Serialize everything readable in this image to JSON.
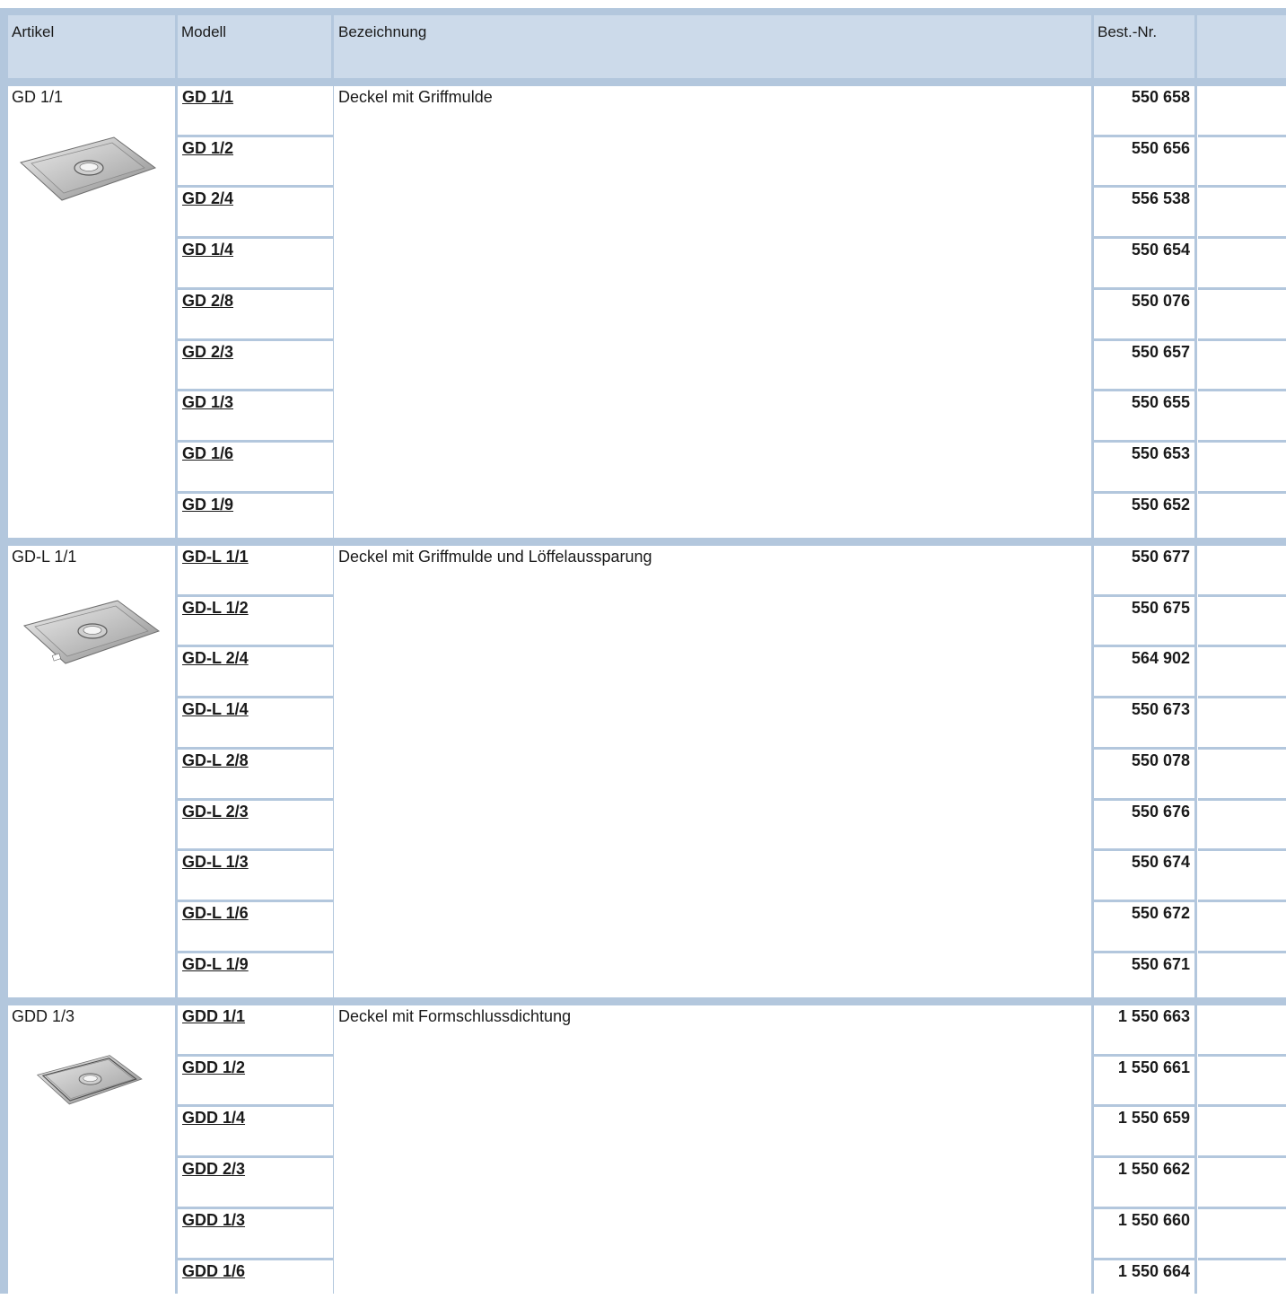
{
  "header": {
    "artikel": "Artikel",
    "modell": "Modell",
    "bezeichnung": "Bezeichnung",
    "best_nr": "Best.-Nr."
  },
  "groups": [
    {
      "artikel": "GD 1/1",
      "image": "gastronorm-lid-with-handle-recess",
      "bezeichnung": "Deckel mit Griffmulde",
      "rows": [
        {
          "modell": "GD 1/1",
          "best_nr": "550 658"
        },
        {
          "modell": "GD 1/2",
          "best_nr": "550 656"
        },
        {
          "modell": "GD 2/4",
          "best_nr": "556 538"
        },
        {
          "modell": "GD 1/4",
          "best_nr": "550 654"
        },
        {
          "modell": "GD 2/8",
          "best_nr": "550 076"
        },
        {
          "modell": "GD 2/3",
          "best_nr": "550 657"
        },
        {
          "modell": "GD 1/3",
          "best_nr": "550 655"
        },
        {
          "modell": "GD 1/6",
          "best_nr": "550 653"
        },
        {
          "modell": "GD 1/9",
          "best_nr": "550 652"
        }
      ]
    },
    {
      "artikel": "GD-L 1/1",
      "image": "gastronorm-lid-with-spoon-notch",
      "bezeichnung": "Deckel mit Griffmulde und Löffelaussparung",
      "rows": [
        {
          "modell": "GD-L 1/1",
          "best_nr": "550 677"
        },
        {
          "modell": "GD-L 1/2",
          "best_nr": "550 675"
        },
        {
          "modell": "GD-L 2/4",
          "best_nr": "564 902"
        },
        {
          "modell": "GD-L 1/4",
          "best_nr": "550 673"
        },
        {
          "modell": "GD-L 2/8",
          "best_nr": "550 078"
        },
        {
          "modell": "GD-L 2/3",
          "best_nr": "550 676"
        },
        {
          "modell": "GD-L 1/3",
          "best_nr": "550 674"
        },
        {
          "modell": "GD-L 1/6",
          "best_nr": "550 672"
        },
        {
          "modell": "GD-L 1/9",
          "best_nr": "550 671"
        }
      ]
    },
    {
      "artikel": "GDD 1/3",
      "image": "gastronorm-lid-with-seal",
      "bezeichnung": "Deckel mit Formschlussdichtung",
      "rows": [
        {
          "modell": "GDD 1/1",
          "best_nr": "1 550 663"
        },
        {
          "modell": "GDD 1/2",
          "best_nr": "1 550 661"
        },
        {
          "modell": "GDD 1/4",
          "best_nr": "1 550 659"
        },
        {
          "modell": "GDD 2/3",
          "best_nr": "1 550 662"
        },
        {
          "modell": "GDD 1/3",
          "best_nr": "1 550 660"
        },
        {
          "modell": "GDD 1/6",
          "best_nr": "1 550 664"
        }
      ]
    }
  ]
}
